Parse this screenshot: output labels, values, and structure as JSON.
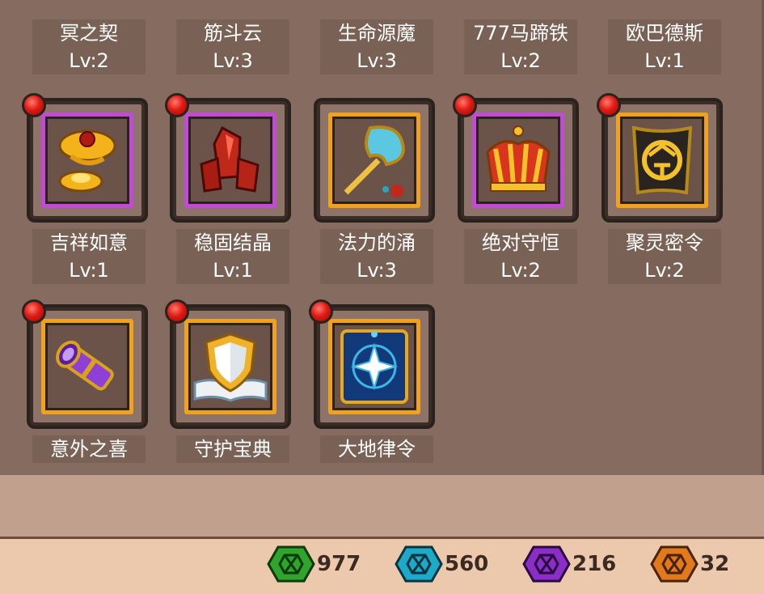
{
  "row1": [
    {
      "name": "冥之契",
      "level": "Lv:2"
    },
    {
      "name": "筋斗云",
      "level": "Lv:3"
    },
    {
      "name": "生命源魔",
      "level": "Lv:3"
    },
    {
      "name": "777马蹄铁",
      "level": "Lv:2"
    },
    {
      "name": "欧巴德斯",
      "level": "Lv:1"
    }
  ],
  "row2": [
    {
      "name": "吉祥如意",
      "level": "Lv:1",
      "icon": "golden-ruyi-icon",
      "frame": "purple"
    },
    {
      "name": "稳固结晶",
      "level": "Lv:1",
      "icon": "red-crystal-icon",
      "frame": "purple"
    },
    {
      "name": "法力的涌",
      "level": "Lv:3",
      "icon": "mana-fan-icon",
      "frame": "orange"
    },
    {
      "name": "绝对守恒",
      "level": "Lv:2",
      "icon": "crown-icon",
      "frame": "purple"
    },
    {
      "name": "聚灵密令",
      "level": "Lv:2",
      "icon": "secret-order-icon",
      "frame": "orange"
    }
  ],
  "row3": [
    {
      "name": "意外之喜",
      "icon": "telescope-icon",
      "frame": "orange"
    },
    {
      "name": "守护宝典",
      "icon": "shield-book-icon",
      "frame": "orange"
    },
    {
      "name": "大地律令",
      "icon": "earth-card-icon",
      "frame": "orange"
    }
  ],
  "currencies": [
    {
      "name": "green-gem-icon",
      "color": "#2fa52b",
      "amount": "977"
    },
    {
      "name": "cyan-gem-icon",
      "color": "#1fa9c8",
      "amount": "560"
    },
    {
      "name": "purple-gem-icon",
      "color": "#8b2ec7",
      "amount": "216"
    },
    {
      "name": "orange-gem-icon",
      "color": "#e07a1a",
      "amount": "32"
    }
  ]
}
